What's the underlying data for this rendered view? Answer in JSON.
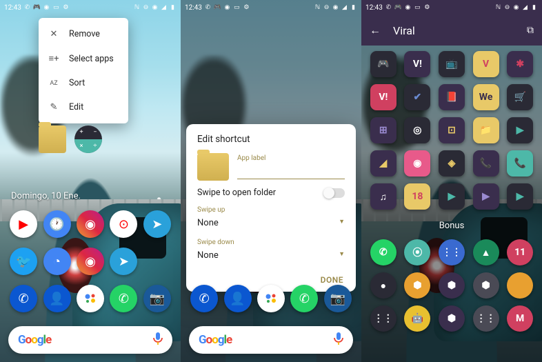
{
  "status": {
    "time": "12:43",
    "icons_left": [
      "whatsapp",
      "controller",
      "instagram",
      "folder",
      "settings"
    ],
    "icons_right": [
      "nfc",
      "dnd",
      "wifi",
      "signal",
      "battery"
    ]
  },
  "screen1": {
    "menu": [
      {
        "icon": "✕",
        "label": "Remove"
      },
      {
        "icon": "≡+",
        "label": "Select apps"
      },
      {
        "icon": "AZ",
        "label": "Sort"
      },
      {
        "icon": "✎",
        "label": "Edit"
      }
    ],
    "date": "Domingo, 10 Ene."
  },
  "screen2": {
    "title": "Edit shortcut",
    "app_label_field": "App label",
    "app_label_value": "",
    "swipe_open": "Swipe to open folder",
    "swipe_up_label": "Swipe up",
    "swipe_up_value": "None",
    "swipe_down_label": "Swipe down",
    "swipe_down_value": "None",
    "done": "DONE"
  },
  "screen3": {
    "title": "Viral",
    "section": "Bonus",
    "icons": [
      {
        "bg": "#2a2a35",
        "fg": "#e8c968",
        "t": "🎮"
      },
      {
        "bg": "#3a2e4d",
        "fg": "#fff",
        "t": "V!"
      },
      {
        "bg": "#2a2a35",
        "fg": "#d04060",
        "t": "📺"
      },
      {
        "bg": "#e8c968",
        "fg": "#d04060",
        "t": "V"
      },
      {
        "bg": "#3a2e4d",
        "fg": "#d04060",
        "t": "✱"
      },
      {
        "bg": "#d04060",
        "fg": "#fff",
        "t": "V!"
      },
      {
        "bg": "#2a2a35",
        "fg": "#6a8ad0",
        "t": "✔"
      },
      {
        "bg": "#3a2e4d",
        "fg": "#e85a8a",
        "t": "📕"
      },
      {
        "bg": "#e8c968",
        "fg": "#3a2e4d",
        "t": "We"
      },
      {
        "bg": "#2a2a35",
        "fg": "#4db8a8",
        "t": "🛒"
      },
      {
        "bg": "#3a2e4d",
        "fg": "#9a8ad0",
        "t": "⊞"
      },
      {
        "bg": "#2a2a35",
        "fg": "#fff",
        "t": "◎"
      },
      {
        "bg": "#3a2e4d",
        "fg": "#e8c968",
        "t": "⊡"
      },
      {
        "bg": "#e8c968",
        "fg": "#3a2e4d",
        "t": "📁"
      },
      {
        "bg": "#2a2a35",
        "fg": "#4db8a8",
        "t": "▶"
      },
      {
        "bg": "#3a2e4d",
        "fg": "#e8c968",
        "t": "◢"
      },
      {
        "bg": "#e85a8a",
        "fg": "#fff",
        "t": "◉"
      },
      {
        "bg": "#2a2a35",
        "fg": "#e8c968",
        "t": "◈"
      },
      {
        "bg": "#3a2e4d",
        "fg": "#4db8a8",
        "t": "📞"
      },
      {
        "bg": "#4db8a8",
        "fg": "#2a2a35",
        "t": "📞"
      },
      {
        "bg": "#3a2e4d",
        "fg": "#fff",
        "t": "♫"
      },
      {
        "bg": "#e8c968",
        "fg": "#d04060",
        "t": "18"
      },
      {
        "bg": "#2a2a35",
        "fg": "#4db8a8",
        "t": "▶"
      },
      {
        "bg": "#3a2e4d",
        "fg": "#9a8ad0",
        "t": "▶"
      },
      {
        "bg": "#2a2a35",
        "fg": "#4db8a8",
        "t": "▶"
      }
    ],
    "bonus": [
      {
        "bg": "#25d366",
        "t": "✆"
      },
      {
        "bg": "#4db8a8",
        "t": "⦿"
      },
      {
        "bg": "#3a6ad0",
        "t": "⋮⋮"
      },
      {
        "bg": "#1a8a5a",
        "t": "▲"
      },
      {
        "bg": "#d04060",
        "t": "11"
      },
      {
        "bg": "#2a2a35",
        "t": "●"
      },
      {
        "bg": "#e8a030",
        "t": "⬢"
      },
      {
        "bg": "#3a2e4d",
        "t": "⬢"
      },
      {
        "bg": "#4a4a55",
        "t": "⬢"
      },
      {
        "bg": "#e8a030",
        "t": ""
      },
      {
        "bg": "#2a2a35",
        "t": "⋮⋮"
      },
      {
        "bg": "#e8c030",
        "t": "🤖"
      },
      {
        "bg": "#3a2e4d",
        "t": "⬢"
      },
      {
        "bg": "#4a4a55",
        "t": "⋮⋮"
      },
      {
        "bg": "#d04060",
        "t": "M"
      }
    ]
  },
  "google": {
    "g": "G",
    "o1": "o",
    "o2": "o",
    "g2": "g",
    "l": "l",
    "e": "e"
  }
}
